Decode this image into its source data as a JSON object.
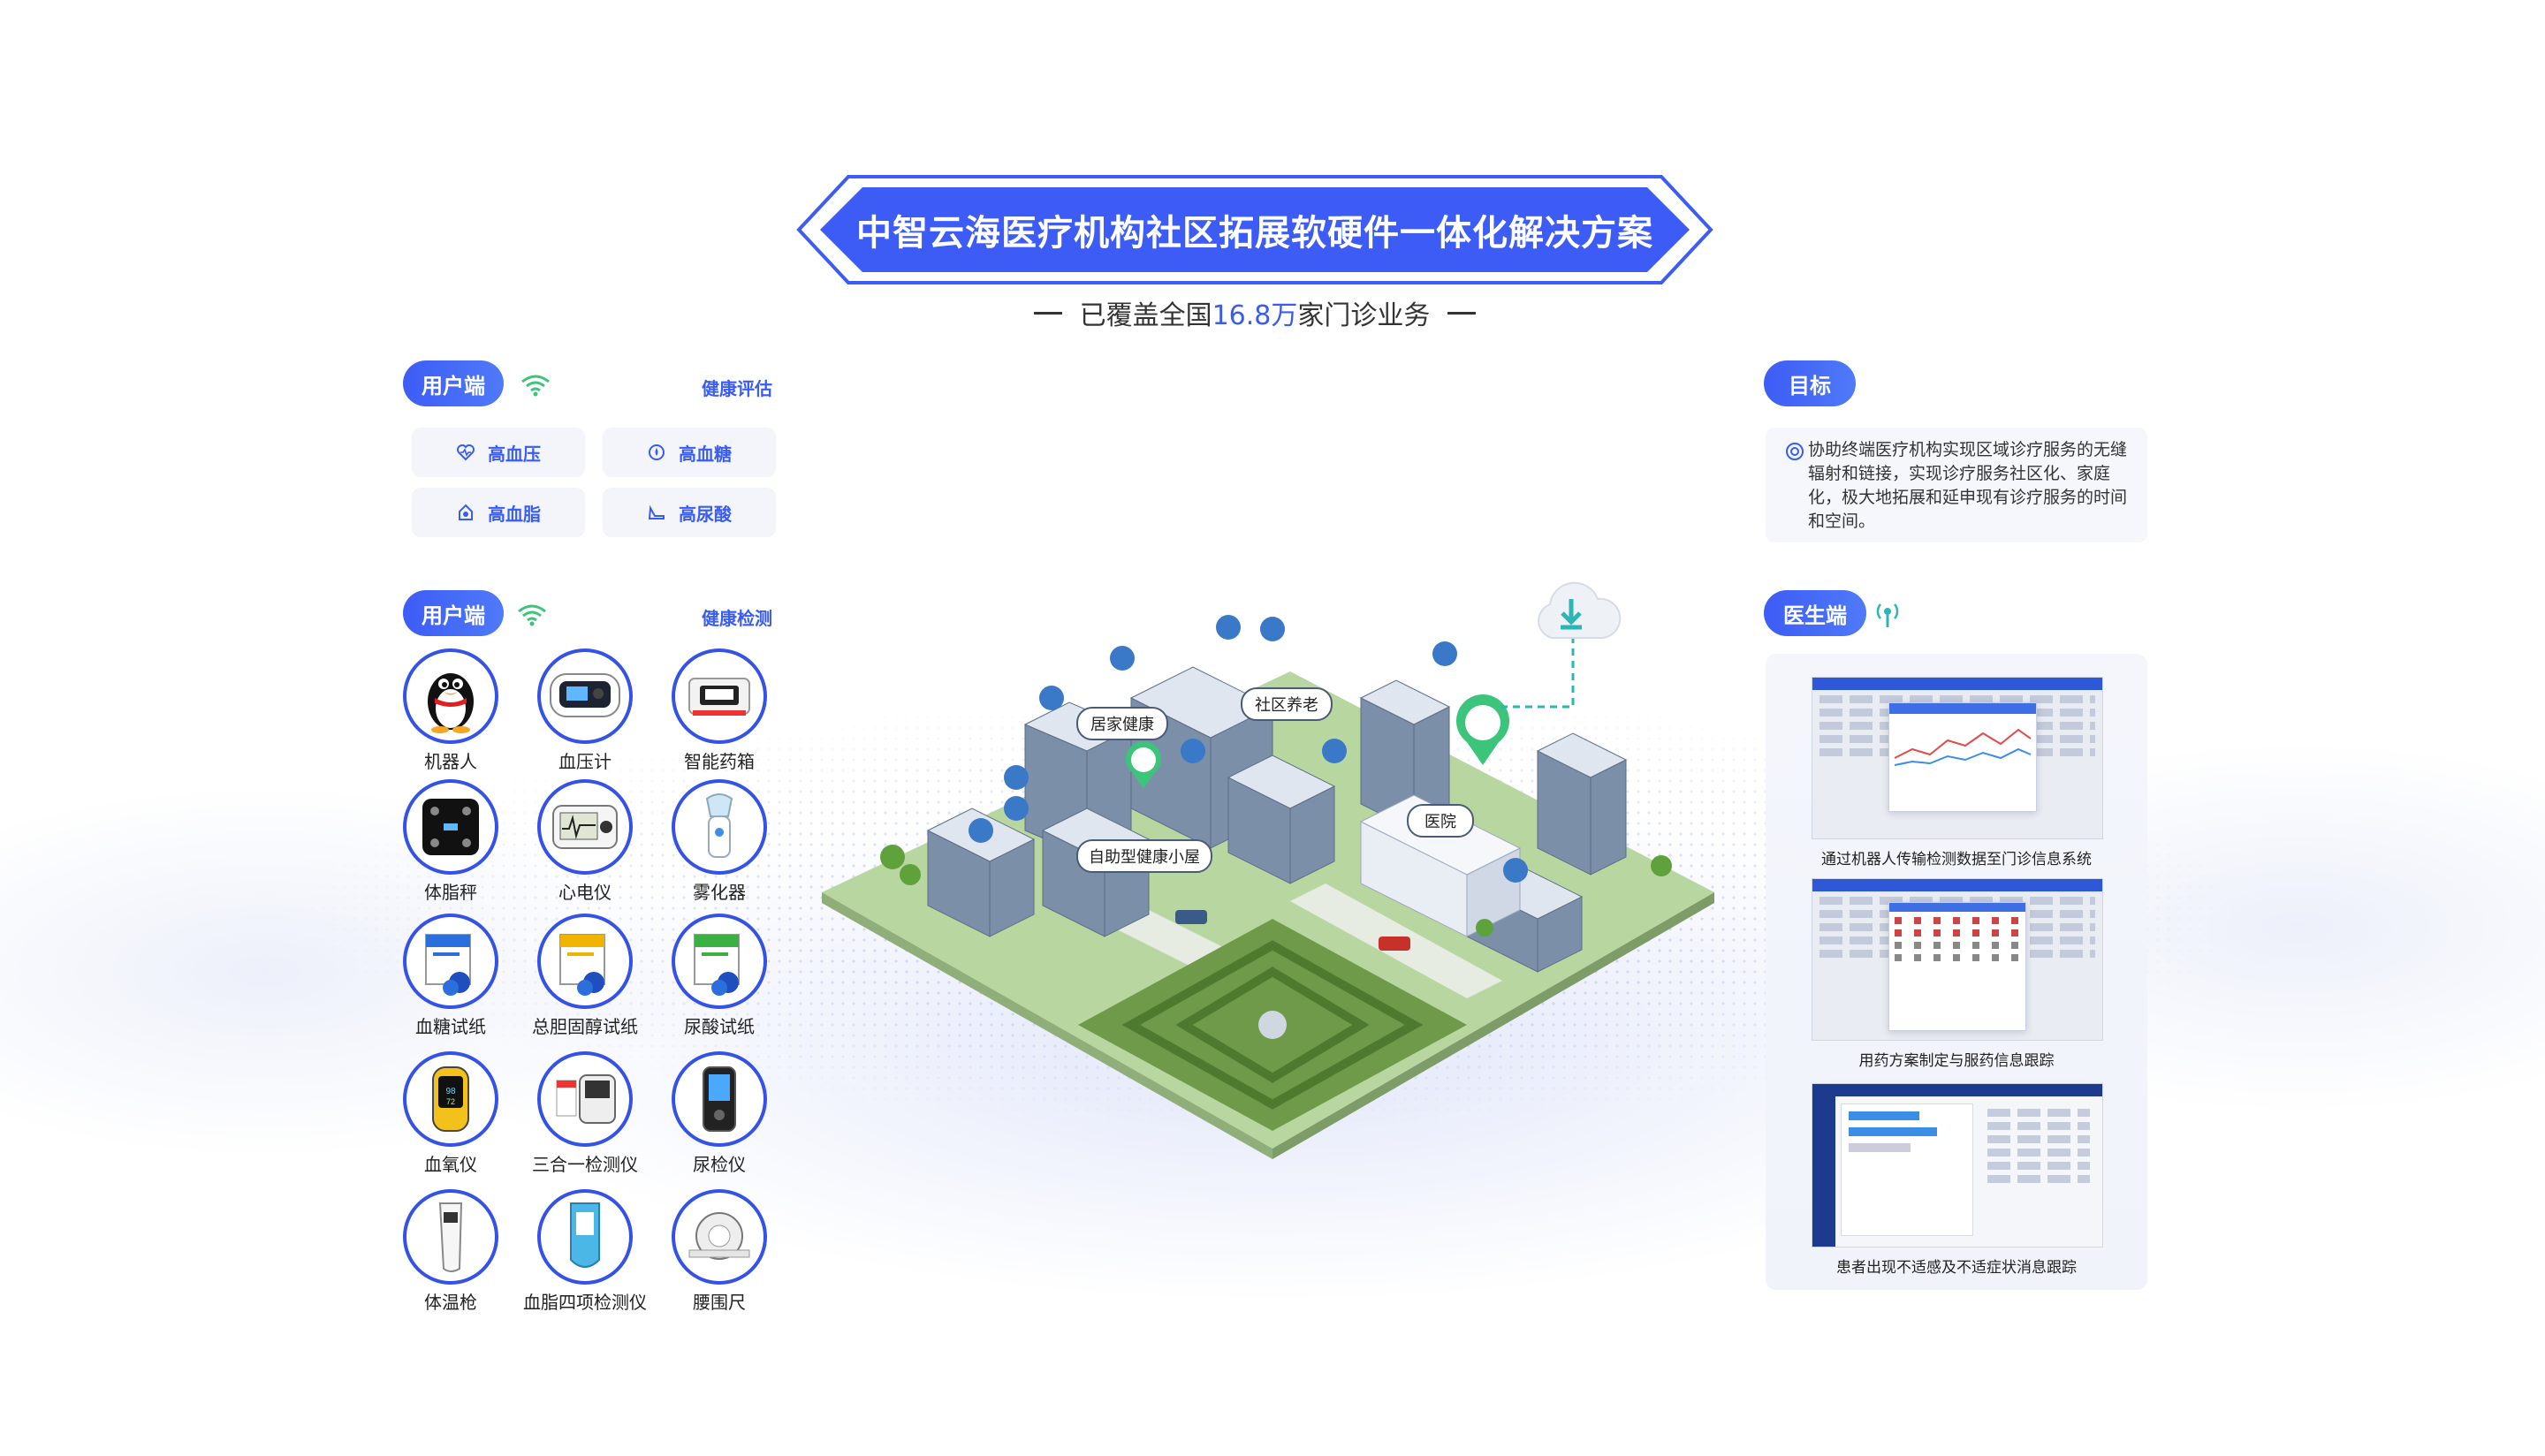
{
  "title": "中智云海医疗机构社区拓展软硬件一体化解决方案",
  "subtitle": {
    "prefix": "已覆盖全国",
    "highlight": "16.8万",
    "suffix": "家门诊业务"
  },
  "left_top": {
    "badge": "用户端",
    "link": "健康评估",
    "tiles": [
      {
        "label": "高血压",
        "icon": "heart-pulse-icon"
      },
      {
        "label": "高血糖",
        "icon": "glucose-icon"
      },
      {
        "label": "高血脂",
        "icon": "lipid-icon"
      },
      {
        "label": "高尿酸",
        "icon": "foot-icon"
      }
    ]
  },
  "left_bottom": {
    "badge": "用户端",
    "link": "健康检测",
    "devices": [
      {
        "label": "机器人",
        "icon": "robot-penguin-icon"
      },
      {
        "label": "血压计",
        "icon": "blood-pressure-monitor-icon"
      },
      {
        "label": "智能药箱",
        "icon": "medicine-box-icon"
      },
      {
        "label": "体脂秤",
        "icon": "body-fat-scale-icon"
      },
      {
        "label": "心电仪",
        "icon": "ecg-device-icon"
      },
      {
        "label": "雾化器",
        "icon": "nebulizer-icon"
      },
      {
        "label": "血糖试纸",
        "icon": "glucose-strip-icon"
      },
      {
        "label": "总胆固醇试纸",
        "icon": "cholesterol-strip-icon"
      },
      {
        "label": "尿酸试纸",
        "icon": "uric-acid-strip-icon"
      },
      {
        "label": "血氧仪",
        "icon": "oximeter-icon"
      },
      {
        "label": "三合一检测仪",
        "icon": "three-in-one-meter-icon"
      },
      {
        "label": "尿检仪",
        "icon": "urine-analyzer-icon"
      },
      {
        "label": "体温枪",
        "icon": "thermometer-gun-icon"
      },
      {
        "label": "血脂四项检测仪",
        "icon": "lipid-analyzer-icon"
      },
      {
        "label": "腰围尺",
        "icon": "tape-measure-icon"
      }
    ]
  },
  "goal": {
    "badge": "目标",
    "text": "协助终端医疗机构实现区域诊疗服务的无缝辐射和链接，实现诊疗服务社区化、家庭化，极大地拓展和延申现有诊疗服务的时间和空间。"
  },
  "doctor": {
    "badge": "医生端",
    "screens": [
      {
        "caption": "通过机器人传输检测数据至门诊信息系统"
      },
      {
        "caption": "用药方案制定与服药信息跟踪"
      },
      {
        "caption": "患者出现不适感及不适症状消息跟踪"
      }
    ]
  },
  "city": {
    "labels": [
      "居家健康",
      "社区养老",
      "自助型健康小屋",
      "医院"
    ]
  },
  "colors": {
    "primary": "#3a5cf0",
    "accent_green": "#3cc47a",
    "text": "#333333"
  }
}
